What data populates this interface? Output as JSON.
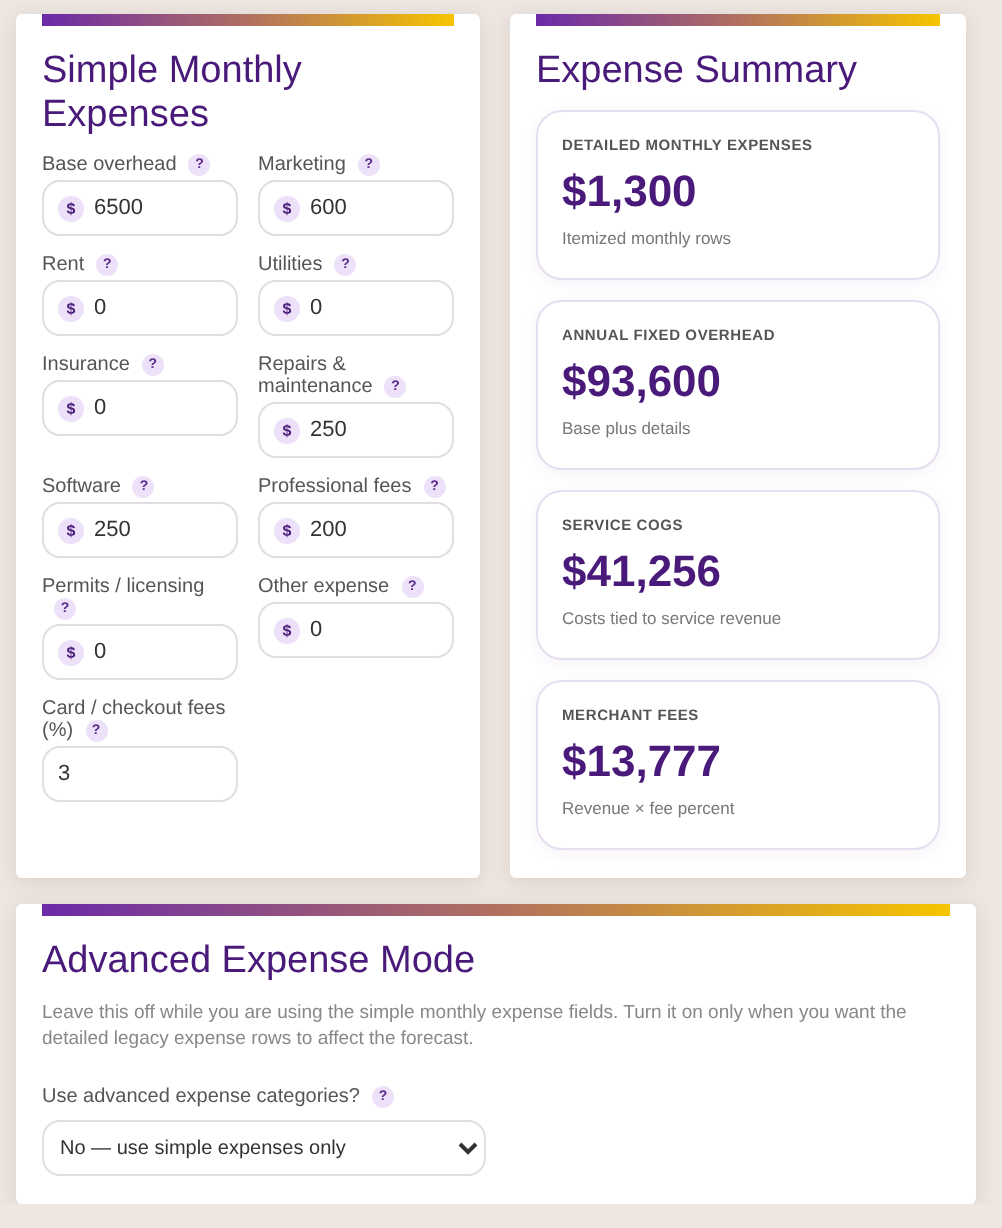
{
  "simple": {
    "title": "Simple Monthly Expenses",
    "fields": [
      {
        "label": "Base overhead",
        "hint": "?",
        "prefix": "$",
        "value": "6500"
      },
      {
        "label": "Marketing",
        "hint": "?",
        "prefix": "$",
        "value": "600"
      },
      {
        "label": "Rent",
        "hint": "?",
        "prefix": "$",
        "value": "0"
      },
      {
        "label": "Utilities",
        "hint": "?",
        "prefix": "$",
        "value": "0"
      },
      {
        "label": "Insurance",
        "hint": "?",
        "prefix": "$",
        "value": "0"
      },
      {
        "label": "Repairs & maintenance",
        "hint": "?",
        "prefix": "$",
        "value": "250"
      },
      {
        "label": "Software",
        "hint": "?",
        "prefix": "$",
        "value": "250"
      },
      {
        "label": "Professional fees",
        "hint": "?",
        "prefix": "$",
        "value": "200"
      },
      {
        "label": "Permits / licensing",
        "hint": "?",
        "prefix": "$",
        "value": "0"
      },
      {
        "label": "Other expense",
        "hint": "?",
        "prefix": "$",
        "value": "0"
      },
      {
        "label": "Card / checkout fees (%)",
        "hint": "?",
        "value": "3"
      }
    ]
  },
  "summary": {
    "title": "Expense Summary",
    "stats": [
      {
        "heading": "DETAILED MONTHLY EXPENSES",
        "value": "$1,300",
        "note": "Itemized monthly rows"
      },
      {
        "heading": "ANNUAL FIXED OVERHEAD",
        "value": "$93,600",
        "note": "Base plus details"
      },
      {
        "heading": "SERVICE COGS",
        "value": "$41,256",
        "note": "Costs tied to service revenue"
      },
      {
        "heading": "MERCHANT FEES",
        "value": "$13,777",
        "note": "Revenue × fee percent"
      }
    ]
  },
  "advanced": {
    "title": "Advanced Expense Mode",
    "description": "Leave this off while you are using the simple monthly expense fields. Turn it on only when you want the detailed legacy expense rows to affect the forecast.",
    "label": "Use advanced expense categories?",
    "hint": "?",
    "value": "No — use simple expenses only"
  }
}
